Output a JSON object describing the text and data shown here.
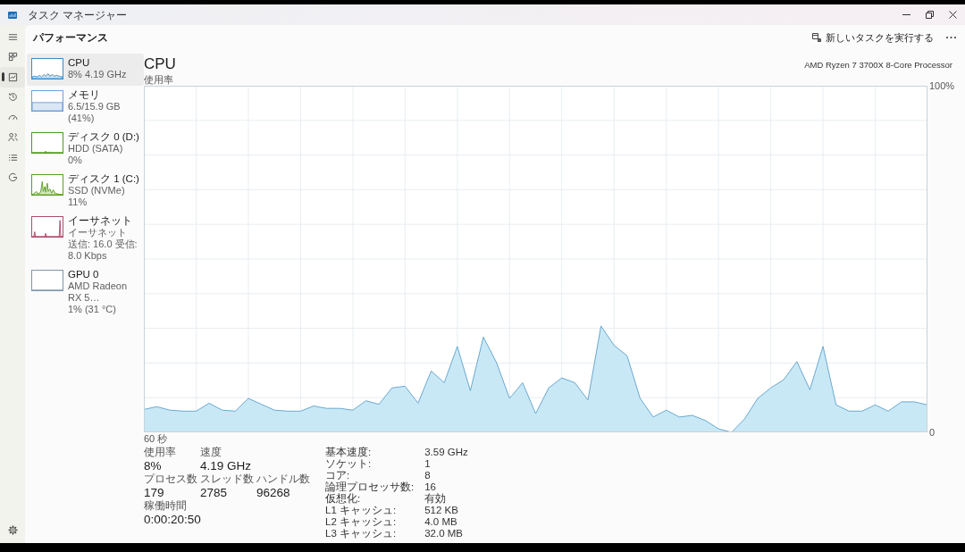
{
  "window": {
    "title": "タスク マネージャー"
  },
  "nav": {
    "items": [
      {
        "selected": false
      },
      {
        "selected": true
      },
      {
        "selected": false
      },
      {
        "selected": false
      },
      {
        "selected": false
      },
      {
        "selected": false
      },
      {
        "selected": false
      }
    ]
  },
  "header": {
    "title": "パフォーマンス",
    "run_task": "新しいタスクを実行する"
  },
  "sidebar_list": [
    {
      "title": "CPU",
      "details": [
        "8% 4.19 GHz"
      ],
      "color": "#3d8cc4",
      "selected": true
    },
    {
      "title": "メモリ",
      "details": [
        "6.5/15.9 GB (41%)"
      ],
      "color": "#6f9fd8",
      "selected": false
    },
    {
      "title": "ディスク 0 (D:)",
      "details": [
        "HDD (SATA)",
        "0%"
      ],
      "color": "#4d9a1a",
      "selected": false
    },
    {
      "title": "ディスク 1 (C:)",
      "details": [
        "SSD (NVMe)",
        "11%"
      ],
      "color": "#5a9e1e",
      "selected": false
    },
    {
      "title": "イーサネット",
      "details": [
        "イーサネット",
        "送信: 16.0 受信: 8.0 Kbps"
      ],
      "color": "#b04a6e",
      "selected": false
    },
    {
      "title": "GPU 0",
      "details": [
        "AMD Radeon RX 5…",
        "1% (31 °C)"
      ],
      "color": "#7f97ad",
      "selected": false
    }
  ],
  "main": {
    "title": "CPU",
    "processor": "AMD Ryzen 7 3700X 8-Core Processor",
    "chart_data": {
      "type": "area",
      "ylabel": "使用率",
      "xlabel": "60 秒",
      "grid": true,
      "categories": [
        null,
        null,
        null,
        null,
        null,
        null,
        null,
        null,
        null,
        null,
        null,
        null,
        null,
        null,
        null,
        null,
        null,
        null,
        null,
        null,
        null,
        null,
        null,
        null,
        null,
        null,
        null,
        null,
        null,
        null,
        null,
        null,
        null,
        null,
        null,
        null,
        null,
        null,
        null,
        null,
        null,
        null,
        null,
        null,
        null,
        null,
        null,
        null,
        null,
        null,
        null,
        null,
        null,
        null,
        null,
        null,
        null,
        null,
        null,
        null,
        null
      ],
      "ylim": [
        0,
        100
      ],
      "yticks": [
        {
          "value": 100,
          "label": "100%"
        },
        {
          "value": 0,
          "label": "0"
        }
      ],
      "values": [
        6.6,
        7.4,
        6.4,
        6.1,
        6.1,
        8.4,
        6.4,
        6.1,
        9.8,
        8.1,
        6.4,
        6.1,
        6.1,
        7.6,
        6.9,
        6.9,
        6.4,
        9.1,
        8.1,
        12.8,
        13.3,
        8.4,
        17.7,
        14.3,
        24.8,
        12.0,
        27.5,
        20.1,
        9.8,
        14.3,
        5.4,
        12.8,
        15.7,
        14.3,
        9.3,
        30.7,
        25.1,
        22.1,
        9.8,
        4.4,
        6.4,
        4.4,
        4.9,
        3.4,
        1.0,
        0,
        3.9,
        9.8,
        12.8,
        15.2,
        20.4,
        12.3,
        24.8,
        7.9,
        6.1,
        6.1,
        7.9,
        6.1,
        8.8,
        8.8,
        7.9
      ]
    },
    "stat_rows": [
      [
        {
          "label": "使用率",
          "value": "8%"
        },
        {
          "label": "速度",
          "value": "4.19 GHz"
        }
      ],
      [
        {
          "label": "プロセス数",
          "value": "179"
        },
        {
          "label": "スレッド数",
          "value": "2785"
        },
        {
          "label": "ハンドル数",
          "value": "96268"
        }
      ],
      [
        {
          "label": "稼働時間",
          "value": "0:00:20:50"
        }
      ]
    ],
    "details": [
      {
        "label": "基本速度:",
        "value": "3.59 GHz"
      },
      {
        "label": "ソケット:",
        "value": "1"
      },
      {
        "label": "コア:",
        "value": "8"
      },
      {
        "label": "論理プロセッサ数:",
        "value": "16"
      },
      {
        "label": "仮想化:",
        "value": "有効"
      },
      {
        "label": "L1 キャッシュ:",
        "value": "512 KB"
      },
      {
        "label": "L2 キャッシュ:",
        "value": "4.0 MB"
      },
      {
        "label": "L3 キャッシュ:",
        "value": "32.0 MB"
      }
    ]
  }
}
